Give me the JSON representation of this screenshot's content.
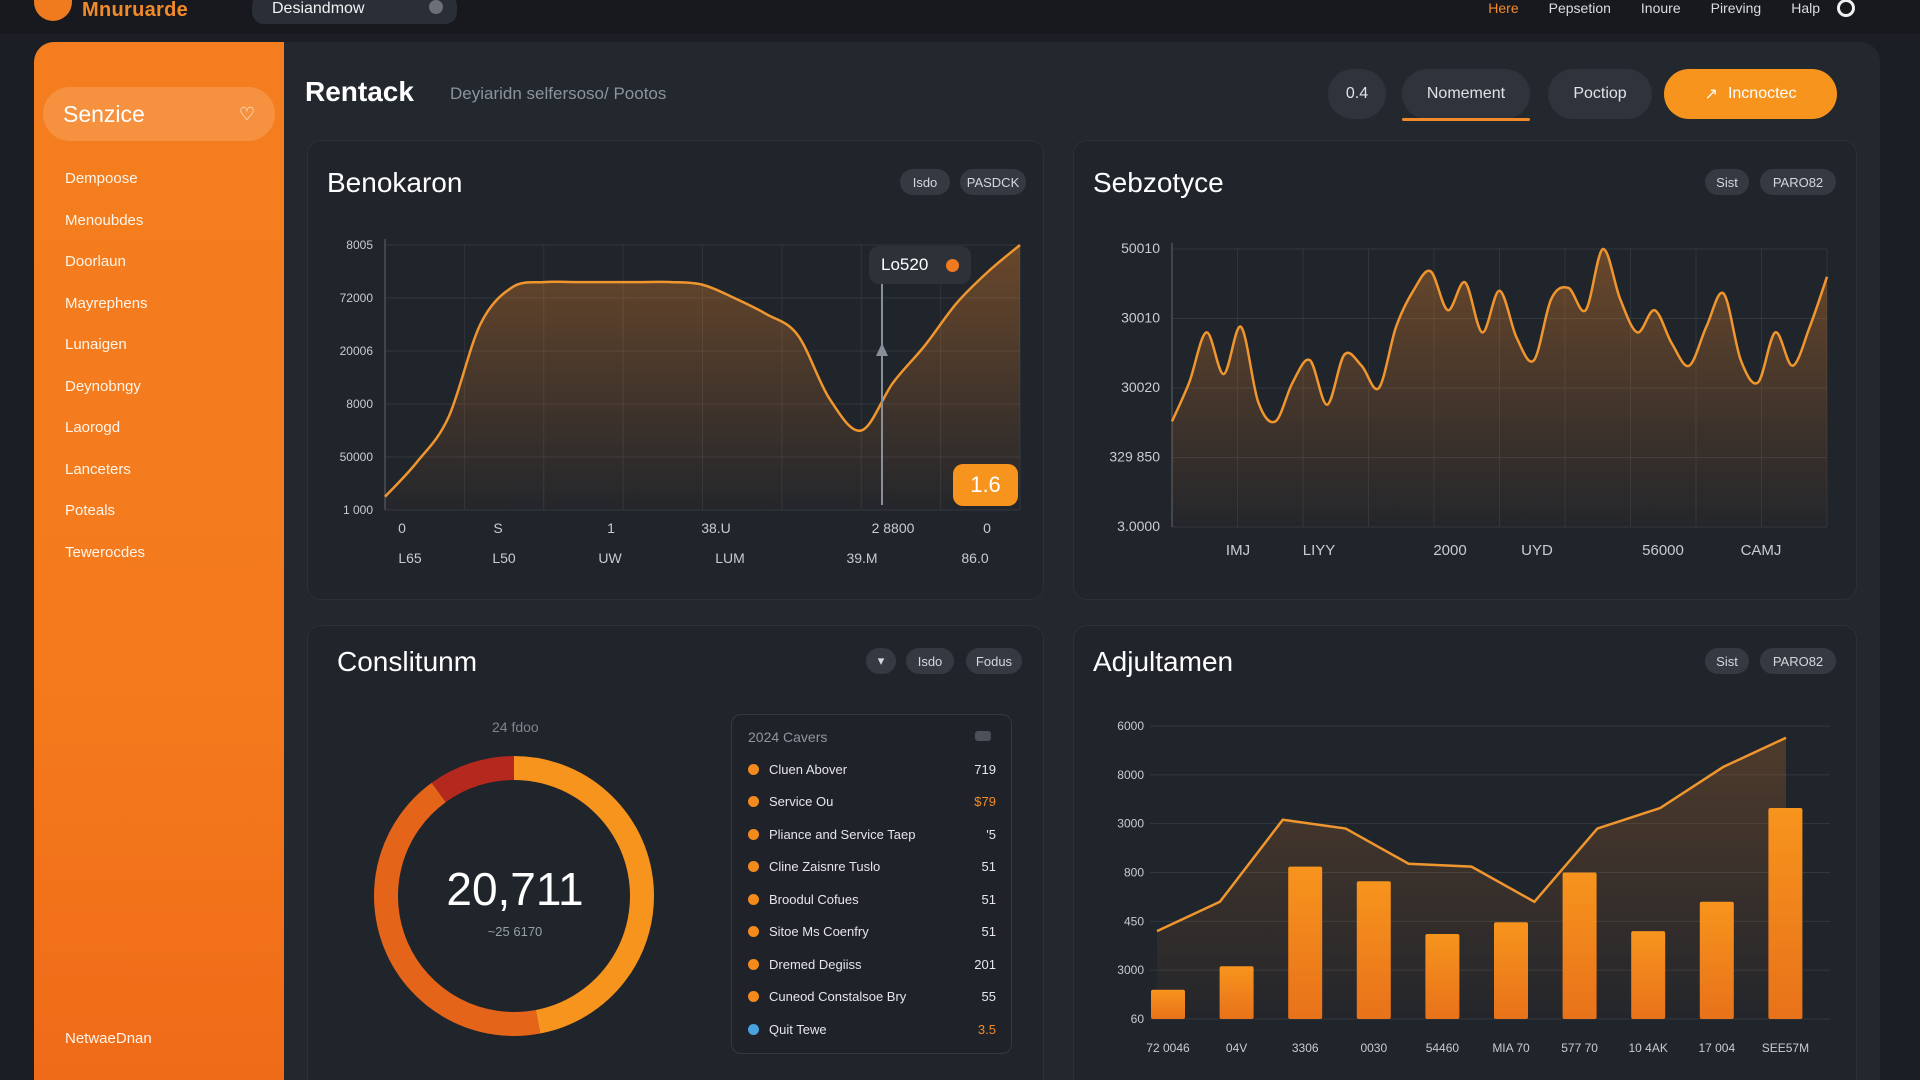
{
  "app": {
    "brand": "Mnuruarde",
    "search_text": "Desiandmow",
    "nav": [
      "Here",
      "Pepsetion",
      "Inoure",
      "Pireving",
      "Halp"
    ],
    "nav_active_index": 0
  },
  "sidebar": {
    "select_label": "Senzice",
    "items": [
      "Dempoose",
      "Menoubdes",
      "Doorlaun",
      "Mayrephens",
      "Lunaigen",
      "Deynobngy",
      "Laorogd",
      "Lanceters",
      "Poteals",
      "Tewerocdes"
    ],
    "footer": "NetwaeDnan"
  },
  "header": {
    "title": "Rentack",
    "breadcrumb": "Deyiaridn selfersoso/ Pootos",
    "pills": [
      "0.4",
      "Nomement",
      "Poctiop"
    ],
    "active_pill_index": 1,
    "cta_label": "Incnoctec"
  },
  "cards": {
    "benokaron": {
      "title": "Benokaron",
      "chips": [
        "Isdo",
        "PASDCK"
      ],
      "callout_label": "Lo520",
      "badge": "1.6"
    },
    "sebzotyce": {
      "title": "Sebzotyce",
      "chips": [
        "Sist",
        "PARO82"
      ]
    },
    "consilitunm": {
      "title": "Conslitunm",
      "chips": [
        "Isdo",
        "Fodus"
      ],
      "donut_caption": "24 fdoo",
      "donut_value": "20,711",
      "donut_sub": "~25 6170",
      "legend_title": "2024 Cavers",
      "legend": [
        {
          "label": "Cluen Abover",
          "value": "719",
          "color": "#f28a1e",
          "value_color": "#e6e8ec"
        },
        {
          "label": "Service Ou",
          "value": "$79",
          "color": "#f28a1e",
          "value_color": "#f28a2a"
        },
        {
          "label": "Pliance and Service Taep",
          "value": "'5",
          "color": "#f28a1e",
          "value_color": "#e6e8ec"
        },
        {
          "label": "Cline Zaisnre Tuslo",
          "value": "51",
          "color": "#f28a1e",
          "value_color": "#e6e8ec"
        },
        {
          "label": "Broodul Cofues",
          "value": "51",
          "color": "#f28a1e",
          "value_color": "#e6e8ec"
        },
        {
          "label": "Sitoe Ms Coenfry",
          "value": "51",
          "color": "#f28a1e",
          "value_color": "#e6e8ec"
        },
        {
          "label": "Dremed Degiiss",
          "value": "201",
          "color": "#f28a1e",
          "value_color": "#e6e8ec"
        },
        {
          "label": "Cuneod Constalsoe Bry",
          "value": "55",
          "color": "#f28a1e",
          "value_color": "#e6e8ec"
        },
        {
          "label": "Quit Tewe",
          "value": "3.5",
          "color": "#4aa3df",
          "value_color": "#f28a2a"
        }
      ]
    },
    "adjultamen": {
      "title": "Adjultamen",
      "chips": [
        "Sist",
        "PARO82"
      ]
    }
  },
  "chart_data": [
    {
      "type": "area",
      "id": "benokaron",
      "title": "Benokaron",
      "y_tick_labels": [
        "8005",
        "72000",
        "20006",
        "8000",
        "50000",
        "1 000"
      ],
      "x_tick_labels_row1": [
        "0",
        "S",
        "1",
        "38.U",
        "2 8800",
        "0"
      ],
      "x_tick_labels_row2": [
        "L65",
        "L50",
        "UW",
        "LUM",
        "39.M",
        "86.0"
      ],
      "ylim": [
        0,
        100
      ],
      "x": [
        0,
        4,
        8,
        12,
        16,
        20,
        24,
        28,
        32,
        36,
        40,
        44,
        48,
        52,
        56,
        60,
        64,
        68,
        72,
        76,
        80
      ],
      "values": [
        5,
        18,
        35,
        70,
        84,
        86,
        86,
        86,
        86,
        86,
        85,
        80,
        74,
        66,
        42,
        30,
        48,
        62,
        78,
        90,
        100
      ]
    },
    {
      "type": "area",
      "id": "sebzotyce",
      "title": "Sebzotyce",
      "y_tick_labels": [
        "50010",
        "30010",
        "30020",
        "329 850",
        "3.0000"
      ],
      "x_tick_labels": [
        "IMJ",
        "LIYY",
        "2000",
        "UYD",
        "56000",
        "CAMJ"
      ],
      "ylim": [
        0,
        100
      ],
      "x": [
        0,
        2,
        4,
        6,
        8,
        10,
        12,
        14,
        16,
        18,
        20,
        22,
        24,
        26,
        28,
        30,
        32,
        34,
        36,
        38,
        40,
        42,
        44,
        46,
        48,
        50,
        52,
        54,
        56,
        58,
        60,
        62,
        64,
        66,
        68,
        70,
        72,
        74,
        76
      ],
      "values": [
        38,
        52,
        70,
        55,
        72,
        45,
        38,
        52,
        60,
        44,
        62,
        58,
        50,
        72,
        85,
        92,
        78,
        88,
        70,
        85,
        68,
        60,
        82,
        86,
        78,
        100,
        82,
        70,
        78,
        66,
        58,
        72,
        84,
        60,
        52,
        70,
        58,
        72,
        90
      ]
    },
    {
      "type": "pie",
      "id": "consilitunm",
      "title": "Conslitunm",
      "center_label": "20,711",
      "slices": [
        {
          "label": "segment-a",
          "value": 47,
          "color": "#f7941d"
        },
        {
          "label": "segment-b",
          "value": 43,
          "color": "#e4641a"
        },
        {
          "label": "segment-c",
          "value": 10,
          "color": "#b5281e"
        }
      ]
    },
    {
      "type": "bar",
      "id": "adjultamen",
      "title": "Adjultamen",
      "y_tick_labels": [
        "6000",
        "8000",
        "3000",
        "800",
        "450",
        "3000",
        "60"
      ],
      "categories": [
        "72 0046",
        "04V",
        "3306",
        "0030",
        "54460",
        "MIA 70",
        "577 70",
        "10 4AK",
        "17 004",
        "SEE57M"
      ],
      "bar_values": [
        10,
        18,
        52,
        47,
        29,
        33,
        50,
        30,
        40,
        72
      ],
      "line_values": [
        30,
        40,
        68,
        65,
        53,
        52,
        40,
        65,
        72,
        86,
        96
      ],
      "ylim": [
        0,
        100
      ]
    }
  ]
}
